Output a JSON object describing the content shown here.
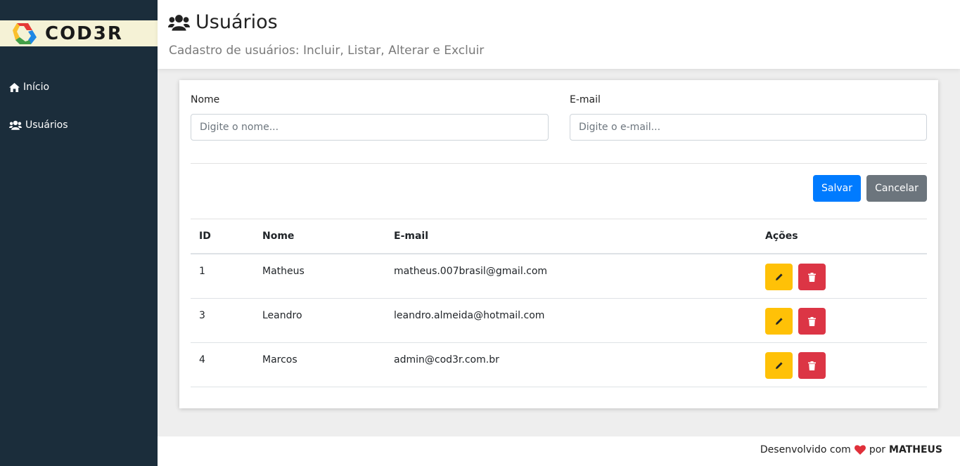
{
  "brand": {
    "logo_text": "COD3R"
  },
  "sidebar": {
    "items": [
      {
        "label": "Início",
        "icon": "home-icon"
      },
      {
        "label": "Usuários",
        "icon": "users-icon"
      }
    ]
  },
  "header": {
    "title": "Usuários",
    "subtitle": "Cadastro de usuários: Incluir, Listar, Alterar e Excluir"
  },
  "form": {
    "name_label": "Nome",
    "name_placeholder": "Digite o nome...",
    "name_value": "",
    "email_label": "E-mail",
    "email_placeholder": "Digite o e-mail...",
    "email_value": "",
    "save_label": "Salvar",
    "cancel_label": "Cancelar"
  },
  "table": {
    "headers": [
      "ID",
      "Nome",
      "E-mail",
      "Ações"
    ],
    "rows": [
      {
        "id": "1",
        "name": "Matheus",
        "email": "matheus.007brasil@gmail.com"
      },
      {
        "id": "3",
        "name": "Leandro",
        "email": "leandro.almeida@hotmail.com"
      },
      {
        "id": "4",
        "name": "Marcos",
        "email": "admin@cod3r.com.br"
      }
    ]
  },
  "footer": {
    "text_prefix": "Desenvolvido com",
    "text_mid": "por",
    "author": "MATHEUS"
  },
  "colors": {
    "sidebar_bg": "#1b2d3b",
    "primary": "#007bff",
    "secondary": "#6c757d",
    "warning": "#ffc107",
    "danger": "#dc3545",
    "heart": "#e0303a"
  }
}
